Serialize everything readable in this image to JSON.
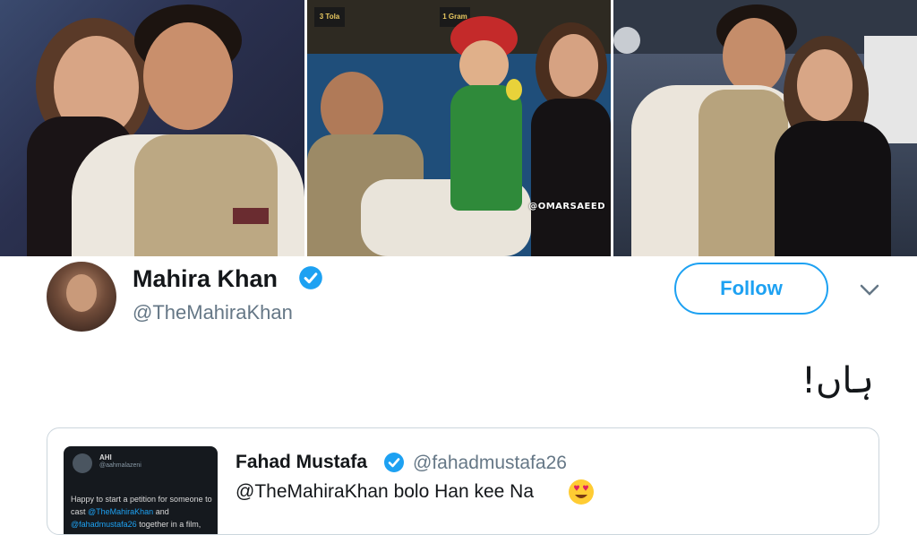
{
  "photos": {
    "watermark": "@OMARSAEED",
    "banners": [
      "3 Tola",
      "1 Gram"
    ]
  },
  "tweet": {
    "display_name": "Mahira Khan",
    "handle": "@TheMahiraKhan",
    "follow_label": "Follow",
    "text": "ہاں!"
  },
  "quote": {
    "display_name": "Fahad Mustafa",
    "handle": "@fahadmustafa26",
    "text": "@TheMahiraKhan bolo Han kee Na",
    "emoji": "smiling-face-with-heart-eyes-icon",
    "thumbnail": {
      "name": "AHI",
      "handle": "@aahmalazeni",
      "text_parts": [
        "Happy to start a petition for someone to cast ",
        "@TheMahiraKhan",
        " and ",
        "@fahadmustafa26",
        " together in a film,"
      ]
    }
  },
  "colors": {
    "accent": "#1da1f2",
    "text": "#14171a",
    "secondary": "#657786",
    "border": "#ccd6dd"
  }
}
